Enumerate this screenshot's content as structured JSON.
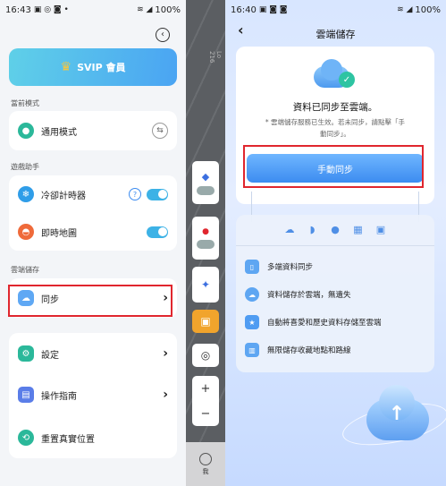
{
  "left": {
    "status": {
      "time": "16:43",
      "battery": "100%"
    },
    "vip_label": "SVIP 會員",
    "sections": {
      "current_mode": "當前模式",
      "game_helper": "遊戲助手",
      "cloud_storage": "雲端儲存"
    },
    "rows": {
      "general_mode": "通用模式",
      "cooldown_timer": "冷卻計時器",
      "help_mark": "?",
      "live_map": "即時地圖",
      "sync": "同步",
      "settings": "設定",
      "guide": "操作指南",
      "reset_location": "重置真實位置"
    }
  },
  "map": {
    "street_label": "Lo 216",
    "zoom_in": "+",
    "zoom_out": "−",
    "bottom_label": "我"
  },
  "right": {
    "status": {
      "time": "16:40",
      "battery": "100%"
    },
    "title": "雲端儲存",
    "synced_heading": "資料已同步至雲端。",
    "note": "* 雲端儲存服務已生效。若未同步，請點擊「手動同步」。",
    "manual_sync": "手動同步",
    "features": [
      "多端資料同步",
      "資料儲存於雲端，無遺失",
      "自動將喜愛和歷史資料存儲至雲端",
      "無限儲存收藏地點和路線"
    ]
  },
  "colors": {
    "accent": "#3c8cf0",
    "toggle": "#3db2e6",
    "highlight": "#e0262e",
    "vip_gradient_start": "#5fd0e8"
  }
}
